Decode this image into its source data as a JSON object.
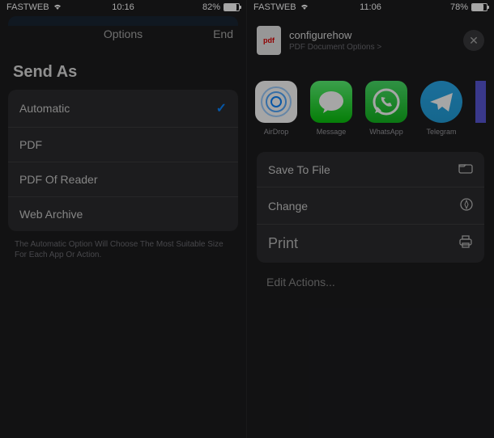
{
  "left": {
    "status": {
      "carrier": "FASTWEB",
      "time": "10:16",
      "battery_text": "82%",
      "battery_pct": 82
    },
    "header": {
      "title": "Options",
      "end": "End"
    },
    "section": "Send As",
    "items": [
      {
        "label": "Automatic",
        "selected": true
      },
      {
        "label": "PDF",
        "selected": false
      },
      {
        "label": "PDF Of Reader",
        "selected": false
      },
      {
        "label": "Web Archive",
        "selected": false
      }
    ],
    "footnote": "The Automatic Option Will Choose The Most Suitable Size For Each App Or Action."
  },
  "right": {
    "status": {
      "carrier": "FASTWEB",
      "time": "11:06",
      "battery_text": "78%",
      "battery_pct": 78
    },
    "doc": {
      "badge": "pdf",
      "title": "configurehow",
      "sub": "PDF Document Options >"
    },
    "apps": [
      {
        "label": "AirDrop"
      },
      {
        "label": "Message"
      },
      {
        "label": "WhatsApp"
      },
      {
        "label": "Telegram"
      }
    ],
    "actions": [
      {
        "label": "Save To File",
        "icon": "folder"
      },
      {
        "label": "Change",
        "icon": "compass"
      },
      {
        "label": "Print",
        "icon": "printer"
      }
    ],
    "edit": "Edit Actions..."
  }
}
